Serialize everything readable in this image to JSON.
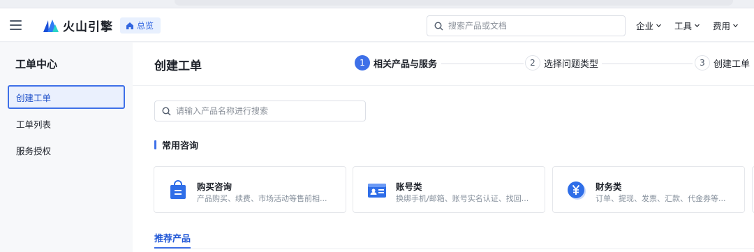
{
  "header": {
    "brand": "火山引擎",
    "home_chip": "总览",
    "search_placeholder": "搜索产品或文档",
    "menus": [
      "企业",
      "工具",
      "费用"
    ]
  },
  "sidebar": {
    "title": "工单中心",
    "items": [
      {
        "label": "创建工单",
        "active": true
      },
      {
        "label": "工单列表",
        "active": false
      },
      {
        "label": "服务授权",
        "active": false
      }
    ]
  },
  "main": {
    "title": "创建工单",
    "steps": [
      {
        "num": "1",
        "label": "相关产品与服务",
        "active": true
      },
      {
        "num": "2",
        "label": "选择问题类型",
        "active": false
      },
      {
        "num": "3",
        "label": "创建工单",
        "active": false
      }
    ],
    "search_placeholder": "请输入产品名称进行搜索",
    "section_title": "常用咨询",
    "cards": [
      {
        "title": "购买咨询",
        "desc": "产品购买、续费、市场活动等售前相...",
        "icon": "shopping-bag-icon"
      },
      {
        "title": "账号类",
        "desc": "换绑手机/邮箱、账号实名认证、找回...",
        "icon": "id-card-icon"
      },
      {
        "title": "财务类",
        "desc": "订单、提现、发票、汇款、代金券等...",
        "icon": "yen-coin-icon"
      }
    ],
    "recommended_tab": "推荐产品"
  },
  "colors": {
    "accent": "#3e70e8",
    "text": "#1d2129",
    "muted": "#86909c",
    "sidebar_bg": "#f7f8fa"
  }
}
